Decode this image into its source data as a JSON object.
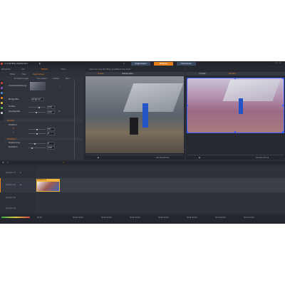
{
  "app": {
    "title": "Live Rooftop_Kopfkamera",
    "menus": [
      "Datei",
      "Edit",
      "Einstellungen"
    ]
  },
  "main_tabs": [
    "Organisieren",
    "Editieren",
    "Exportieren"
  ],
  "left_panel": {
    "tabs": [
      "Bibliothek",
      "Info",
      "Effekte",
      "Titel"
    ],
    "subtabs": [
      "Filter",
      "Titel",
      "Keyframes"
    ],
    "options": [
      "Einstellungen",
      "Favoriten",
      "Letzte",
      "Neu"
    ],
    "labels": {
      "preset": "Videoeinstellung",
      "presetDrop": "Original",
      "p1": "Bildgröße",
      "p2": "Größe",
      "p3": "Quellgröße",
      "section1": "Quelle",
      "section2": "Rotation",
      "pos": "Position",
      "x": "X",
      "y": "Y",
      "scale": "Skalierung",
      "rot": "Rotation"
    },
    "values": [
      "100",
      "100",
      "50",
      "0",
      "0",
      "100",
      "0"
    ]
  },
  "source_monitor": {
    "title": "spinner Live Rooftop_Kopfkamera.mp4",
    "tabs": [
      "Quelle",
      "Wiedergabe"
    ],
    "timecode": "00:00:00:00"
  },
  "program_monitor": {
    "tabs": [
      "Projekt",
      "Kamera"
    ],
    "timecode": "00:00:08:14"
  },
  "tracks": [
    {
      "name": "(V) Spur (1)"
    },
    {
      "name": "(V) Spur (2)"
    },
    {
      "name": "(V) Spur (3)"
    },
    {
      "name": "(V) Spur (4)"
    }
  ],
  "clip": {
    "label": "Kopfkamera"
  },
  "ruler": [
    "00:00",
    "00:00:10:00",
    "00:00:20:00",
    "00:00:30:00",
    "00:00:40:00",
    "00:00:50:00",
    "00:01:00:00",
    "00:01:10:00"
  ],
  "colors": {
    "accent": "#e8801e",
    "selection": "#3b5cff"
  }
}
